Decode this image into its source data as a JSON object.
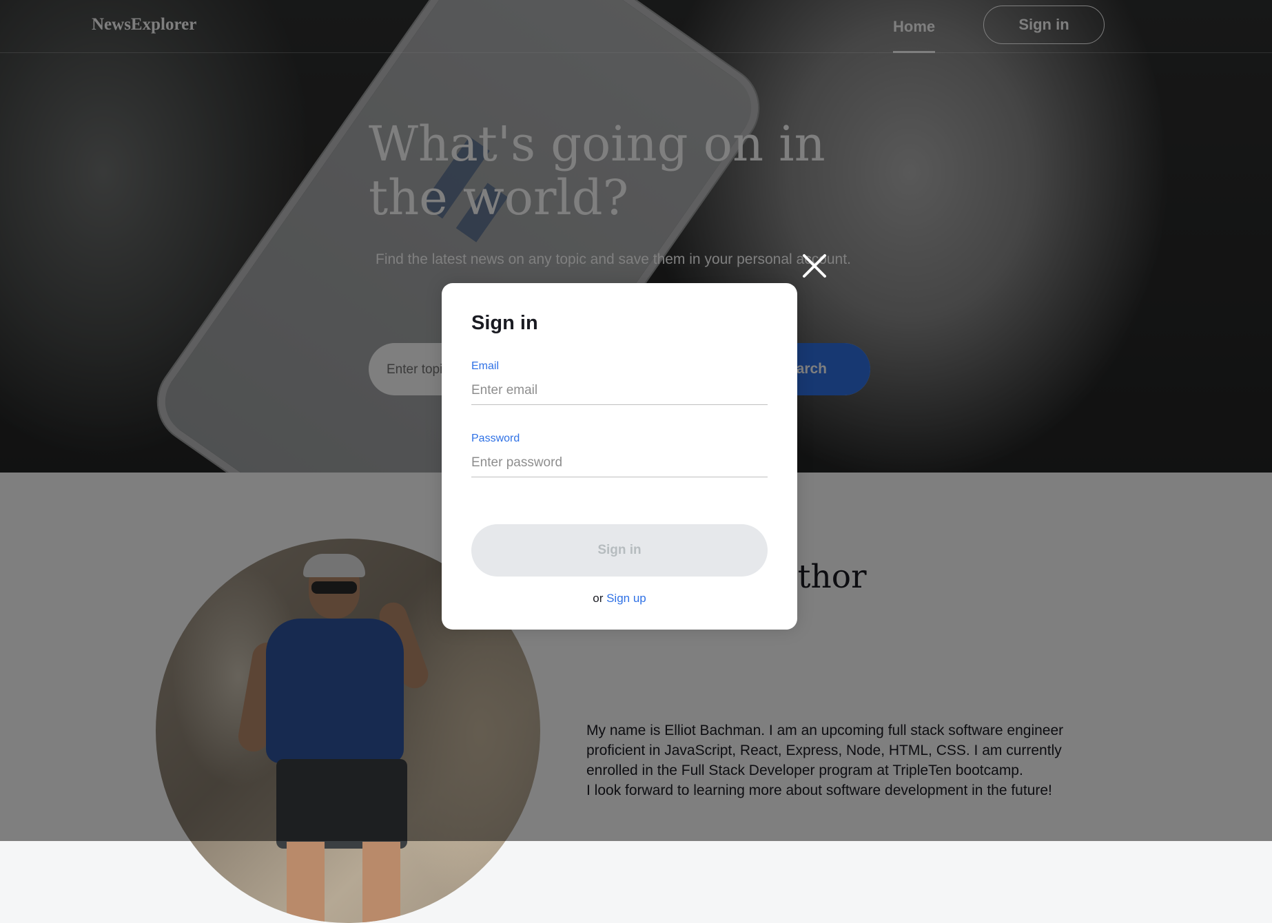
{
  "header": {
    "logo": "NewsExplorer",
    "nav_home": "Home",
    "nav_signin": "Sign in"
  },
  "hero": {
    "title": "What's going on in the world?",
    "subtitle": "Find the latest news on any topic and save them in your personal account.",
    "search_placeholder": "Enter topic",
    "search_button": "Search"
  },
  "about": {
    "heading": "About the author",
    "paragraphs": [
      "My name is Elliot Bachman. I am an upcoming full stack software engineer proficient in JavaScript, React, Express, Node, HTML, CSS. I am currently enrolled in the Full Stack Developer program at TripleTen bootcamp.",
      "I look forward to learning more about software development in the future!"
    ]
  },
  "modal": {
    "title": "Sign in",
    "email_label": "Email",
    "email_placeholder": "Enter email",
    "password_label": "Password",
    "password_placeholder": "Enter password",
    "submit_label": "Sign in",
    "switch_prefix": "or",
    "switch_link": "Sign up",
    "close_icon": "close-icon"
  },
  "colors": {
    "accent": "#2f71e5",
    "text": "#1a1b22",
    "disabled_bg": "#e6e8eb",
    "disabled_text": "#b6bcbf"
  }
}
